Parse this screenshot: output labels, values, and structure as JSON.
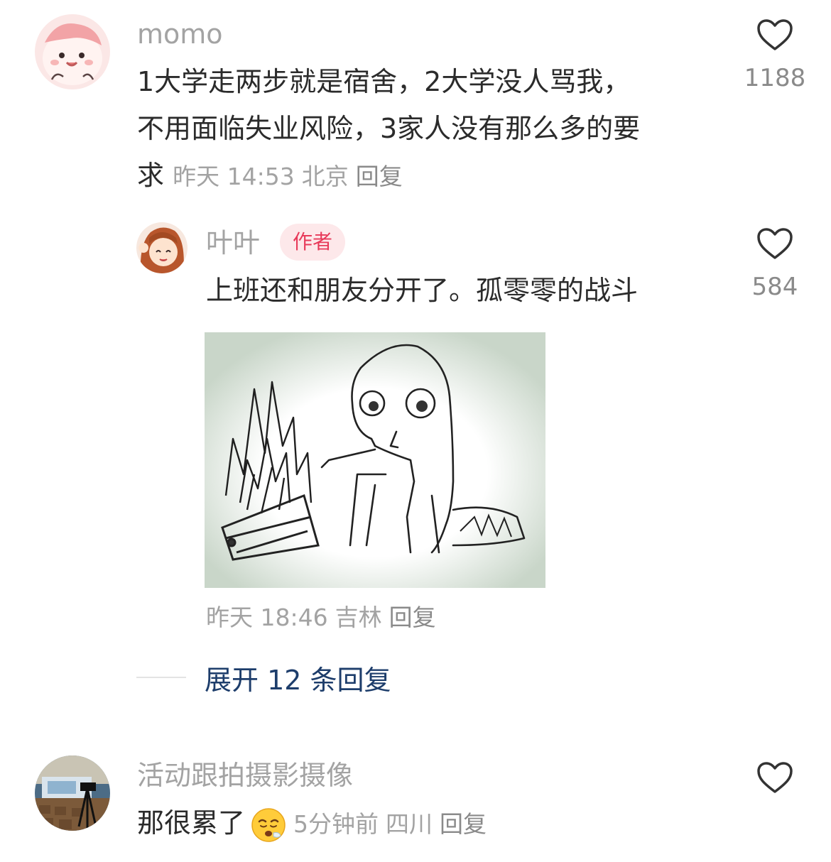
{
  "comments": [
    {
      "username": "momo",
      "text_line1": "1大学走两步就是宿舍，2大学没人骂我，",
      "text_line2": "不用面临失业风险，3家人没有那么多的要",
      "text_line3": "求",
      "time": "昨天 14:53",
      "location": "北京",
      "reply_label": "回复",
      "likes": "1188"
    },
    {
      "username": "叶叶",
      "author_badge": "作者",
      "text": "上班还和朋友分开了。孤零零的战斗",
      "time": "昨天 18:46",
      "location": "吉林",
      "reply_label": "回复",
      "likes": "584"
    },
    {
      "username": "活动跟拍摄影摄像",
      "text": "那很累了",
      "time": "5分钟前",
      "location": "四川",
      "reply_label": "回复"
    }
  ],
  "expand_replies": "展开 12 条回复",
  "colors": {
    "username": "#a3a3a3",
    "text": "#2b2b2b",
    "author_badge_bg": "#fde8ea",
    "author_badge_text": "#e83a5a",
    "expand_link": "#1d3d6b"
  },
  "icons": {
    "like": "heart-outline-icon",
    "emoji": "tired-face-emoji"
  }
}
